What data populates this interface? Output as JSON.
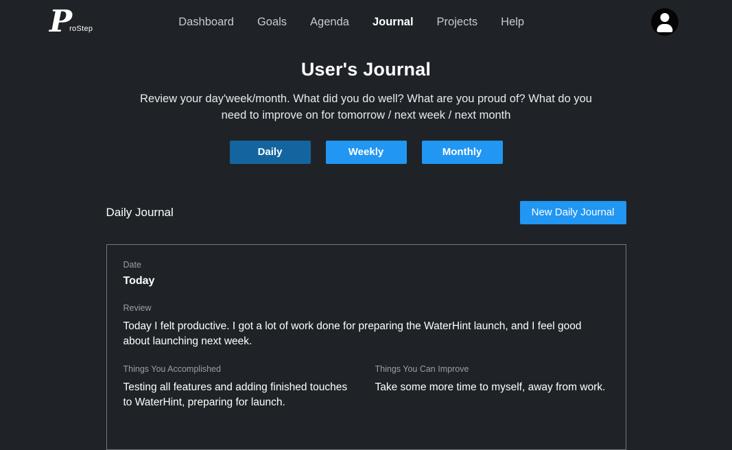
{
  "brand": {
    "logo_letter": "P",
    "logo_rest": "roStep"
  },
  "nav": {
    "items": [
      {
        "label": "Dashboard",
        "active": false
      },
      {
        "label": "Goals",
        "active": false
      },
      {
        "label": "Agenda",
        "active": false
      },
      {
        "label": "Journal",
        "active": true
      },
      {
        "label": "Projects",
        "active": false
      },
      {
        "label": "Help",
        "active": false
      }
    ]
  },
  "header": {
    "title": "User's Journal",
    "subtitle": "Review your day'week/month. What did you do well? What are you proud of? What do you need to improve on for tomorrow / next week / next month"
  },
  "period_tabs": {
    "daily": "Daily",
    "weekly": "Weekly",
    "monthly": "Monthly"
  },
  "section": {
    "title": "Daily Journal",
    "new_button": "New Daily Journal"
  },
  "journal_entry": {
    "date_label": "Date",
    "date_value": "Today",
    "review_label": "Review",
    "review_text": "Today I felt productive. I got a lot of work done for preparing the WaterHint launch, and I feel good about launching next week.",
    "accomplished_label": "Things You Accomplished",
    "accomplished_text": "Testing all features and adding finished touches to WaterHint, preparing for launch.",
    "improve_label": "Things You Can Improve",
    "improve_text": "Take some more time to myself, away from work."
  },
  "icons": {
    "avatar": "person-icon"
  },
  "colors": {
    "background": "#1f2327",
    "accent_blue": "#2196f3",
    "active_tab_blue": "#1464a0",
    "muted_label": "#9aa0a6"
  }
}
